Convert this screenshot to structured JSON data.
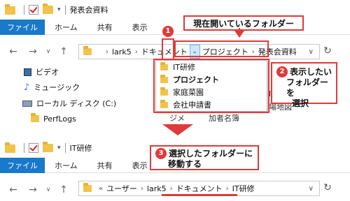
{
  "top": {
    "title": "発表会資料",
    "ribbon": {
      "file": "ファイル",
      "tabs": [
        "ホーム",
        "共有",
        "表示"
      ]
    },
    "breadcrumb": [
      "lark5",
      "ドキュメント",
      "プロジェクト",
      "発表会資料"
    ],
    "sidebar": [
      "ビデオ",
      "ミュージック",
      "ローカル ディスク (C:)",
      "PerfLogs"
    ],
    "dropdown": [
      "IT研修",
      "プロジェクト",
      "家庭菜園",
      "会社申請書"
    ],
    "columns": [
      "ジメ",
      "加者名簿"
    ],
    "right_partial": "場地図",
    "callout_top": "現在開いているフォルダー",
    "callout_select": [
      "表示したい",
      "フォルダーを",
      "選択"
    ],
    "num1": "1",
    "num2": "2"
  },
  "bottom": {
    "title": "IT研修",
    "ribbon": {
      "file": "ファイル",
      "tabs": [
        "ホーム",
        "共有",
        "表示"
      ]
    },
    "breadcrumb": [
      "ユーザー",
      "lark5",
      "ドキュメント",
      "IT研修"
    ],
    "callout": [
      "選択したフォルダーに",
      "移動する"
    ],
    "num3": "3"
  },
  "colors": {
    "accent": "#1979ca",
    "highlight": "#cce8ff",
    "callout_red": "#e03a3a"
  }
}
